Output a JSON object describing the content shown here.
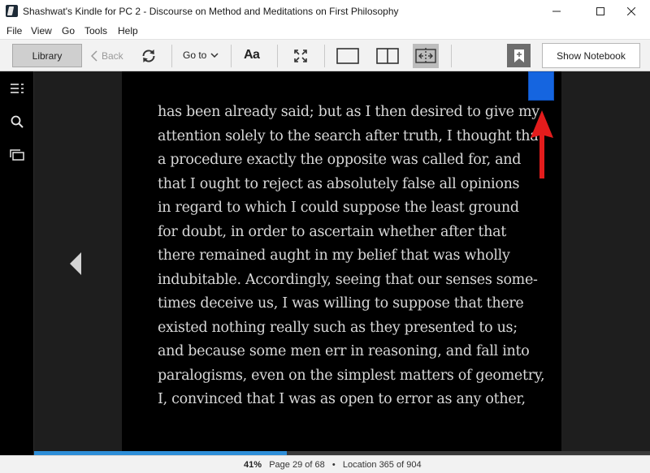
{
  "window": {
    "title": "Shashwat's Kindle for PC 2 - Discourse on Method and Meditations on First Philosophy"
  },
  "menu": {
    "items": [
      "File",
      "View",
      "Go",
      "Tools",
      "Help"
    ]
  },
  "toolbar": {
    "library_label": "Library",
    "back_label": "Back",
    "goto_label": "Go to",
    "font_label": "Aa",
    "notebook_label": "Show Notebook"
  },
  "icons": {
    "app": "kindle-app-icon",
    "minimize": "minimize-icon",
    "maximize": "maximize-icon",
    "close": "close-icon",
    "back": "chevron-left-icon",
    "sync": "sync-icon",
    "goto_caret": "chevron-down-icon",
    "fullscreen": "fullscreen-icon",
    "single_column": "single-column-icon",
    "two_column": "two-column-icon",
    "continuous": "continuous-scroll-icon",
    "bookmark": "bookmark-add-icon",
    "toc": "table-of-contents-icon",
    "search": "search-icon",
    "flashcards": "flashcards-icon",
    "prev_page": "previous-page-icon"
  },
  "page": {
    "lines": [
      "has been already said; but as I then desired to give my",
      "attention solely to the search after truth, I thought that",
      "a procedure exactly the opposite was called for, and",
      "that I ought to reject as absolutely false all opinions",
      "in regard to which I could suppose the least ground",
      "for doubt, in order to ascertain whether after that",
      "there remained aught in my belief that was wholly",
      "indubitable. Accordingly, seeing that our senses some-",
      "times deceive us, I was willing to suppose that there",
      "existed nothing really such as they presented to us;",
      "and because some men err in reasoning, and fall into",
      "paralogisms, even on the simplest matters of geometry,",
      "I, convinced that I was as open to error as any other,"
    ]
  },
  "progress": {
    "fraction": 0.41
  },
  "status": {
    "percent": "41%",
    "page": "Page 29 of 68",
    "separator": "•",
    "location": "Location 365 of 904"
  },
  "colors": {
    "page_background": "#000000",
    "text": "#d8d8d8",
    "bookmark_ribbon": "#1565e0",
    "annotation_arrow": "#e31c1c",
    "progress": "#2e8ed8"
  }
}
